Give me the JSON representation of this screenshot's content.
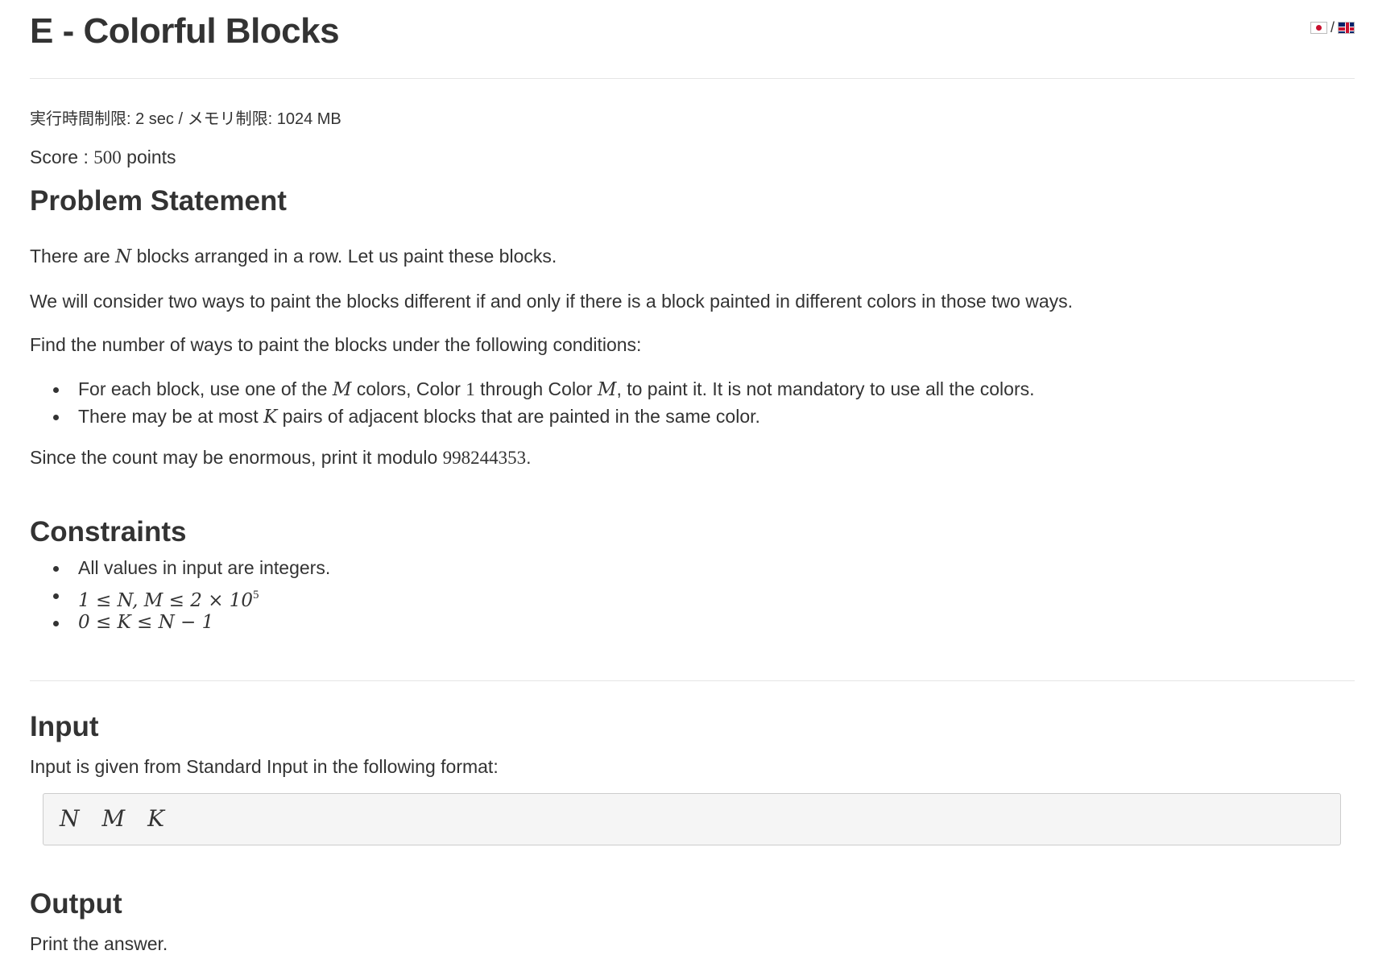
{
  "header": {
    "title": "E - Colorful Blocks",
    "lang_separator": "/"
  },
  "limits": "実行時間制限: 2 sec / メモリ制限: 1024 MB",
  "score": {
    "prefix": "Score : ",
    "value": "500",
    "suffix": " points"
  },
  "problem": {
    "heading": "Problem Statement",
    "p1": {
      "a": "There are ",
      "v": "N",
      "b": " blocks arranged in a row. Let us paint these blocks."
    },
    "p2": "We will consider two ways to paint the blocks different if and only if there is a block painted in different colors in those two ways.",
    "p3": "Find the number of ways to paint the blocks under the following conditions:",
    "bullets": [
      {
        "a": "For each block, use one of the ",
        "v1": "M",
        "b": " colors, Color ",
        "n1": "1",
        "c": " through Color ",
        "v2": "M",
        "d": ", to paint it. It is not mandatory to use all the colors."
      },
      {
        "a": "There may be at most ",
        "v1": "K",
        "b": " pairs of adjacent blocks that are painted in the same color."
      }
    ],
    "p4": {
      "a": "Since the count may be enormous, print it modulo ",
      "n": "998244353",
      "b": "."
    }
  },
  "constraints": {
    "heading": "Constraints",
    "items": [
      {
        "text": "All values in input are integers."
      },
      {
        "text": "1 ≤ N, M ≤ 2 × 10",
        "sup": "5"
      },
      {
        "text": "0 ≤ K ≤ N − 1"
      }
    ]
  },
  "input": {
    "heading": "Input",
    "desc": "Input is given from Standard Input in the following format:",
    "format": [
      "N",
      "M",
      "K"
    ]
  },
  "output": {
    "heading": "Output",
    "desc": "Print the answer."
  }
}
